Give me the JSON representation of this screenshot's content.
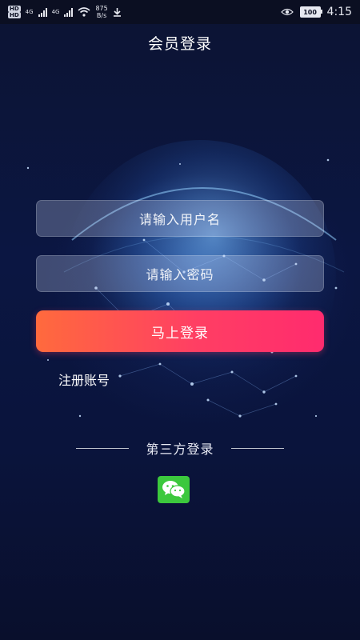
{
  "status_bar": {
    "hd_top": "HD",
    "hd_bottom": "HD",
    "net_type_1": "4G",
    "net_type_2": "4G",
    "rate_value": "875",
    "rate_unit": "B/s",
    "battery": "100",
    "time": "4:15"
  },
  "page": {
    "title": "会员登录"
  },
  "form": {
    "username_placeholder": "请输入用户名",
    "password_placeholder": "请输入密码",
    "login_button": "马上登录",
    "register_link": "注册账号"
  },
  "third_party": {
    "label": "第三方登录",
    "providers": [
      "wechat-icon"
    ]
  },
  "colors": {
    "background": "#0a1030",
    "button_gradient_start": "#ff6a3d",
    "button_gradient_end": "#ff2b6e",
    "wechat_green": "#3cc83d"
  }
}
